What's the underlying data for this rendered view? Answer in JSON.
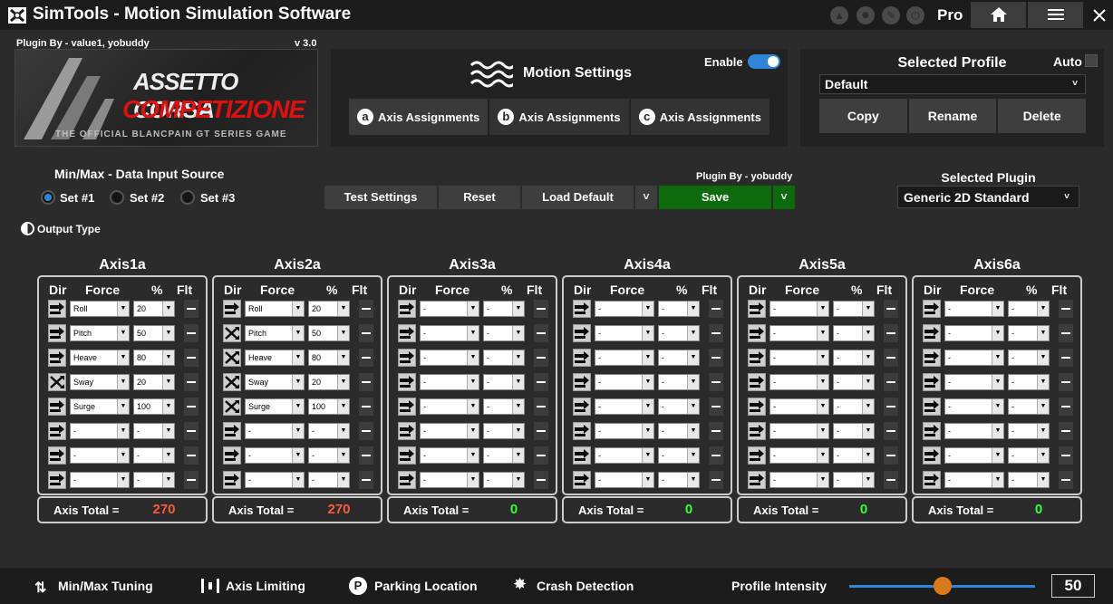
{
  "titlebar": {
    "title": "SimTools - Motion Simulation Software",
    "edition": "Pro",
    "icons": [
      "upload-icon",
      "badge-icon",
      "wrench-icon",
      "power-icon"
    ],
    "nav_buttons": [
      "home-icon",
      "menu-icon",
      "close-icon"
    ]
  },
  "plugin_info": {
    "authors": "Plugin By - value1, yobuddy",
    "version": "v 3.0",
    "image_text_line1": "ASSETTO CORSA",
    "image_text_line2": "COMPETIZIONE",
    "image_text_line3": "THE OFFICIAL BLANCPAIN GT SERIES GAME"
  },
  "motion_settings": {
    "title": "Motion Settings",
    "enable_label": "Enable",
    "tabs": [
      {
        "letter": "a",
        "label": "Axis Assignments"
      },
      {
        "letter": "b",
        "label": "Axis Assignments"
      },
      {
        "letter": "c",
        "label": "Axis Assignments"
      }
    ]
  },
  "profile": {
    "title": "Selected Profile",
    "auto_label": "Auto",
    "selected": "Default",
    "buttons": {
      "copy": "Copy",
      "rename": "Rename",
      "delete": "Delete"
    }
  },
  "data_source": {
    "title": "Min/Max - Data Input Source",
    "sets": [
      "Set #1",
      "Set #2",
      "Set #3"
    ],
    "selected": 0
  },
  "output_type": "Output Type",
  "actions": {
    "test": "Test Settings",
    "reset": "Reset",
    "load_default": "Load Default",
    "save": "Save",
    "plugin_by": "Plugin By - yobuddy"
  },
  "selected_plugin": {
    "title": "Selected Plugin",
    "value": "Generic 2D Standard"
  },
  "axis_headers": {
    "dir": "Dir",
    "force": "Force",
    "pct": "%",
    "flt": "Flt"
  },
  "axis_total_label": "Axis Total =",
  "axes": [
    {
      "name": "Axis1a",
      "total": "270",
      "total_color": "#ff5a3c",
      "rows": [
        {
          "dir": "normal",
          "force": "Roll",
          "pct": "20"
        },
        {
          "dir": "normal",
          "force": "Pitch",
          "pct": "50"
        },
        {
          "dir": "normal",
          "force": "Heave",
          "pct": "80"
        },
        {
          "dir": "reverse",
          "force": "Sway",
          "pct": "20"
        },
        {
          "dir": "normal",
          "force": "Surge",
          "pct": "100"
        },
        {
          "dir": "normal",
          "force": "-",
          "pct": "-"
        },
        {
          "dir": "normal",
          "force": "-",
          "pct": "-"
        },
        {
          "dir": "normal",
          "force": "-",
          "pct": "-"
        }
      ]
    },
    {
      "name": "Axis2a",
      "total": "270",
      "total_color": "#ff5a3c",
      "rows": [
        {
          "dir": "normal",
          "force": "Roll",
          "pct": "20"
        },
        {
          "dir": "reverse",
          "force": "Pitch",
          "pct": "50"
        },
        {
          "dir": "reverse",
          "force": "Heave",
          "pct": "80"
        },
        {
          "dir": "reverse",
          "force": "Sway",
          "pct": "20"
        },
        {
          "dir": "reverse",
          "force": "Surge",
          "pct": "100"
        },
        {
          "dir": "normal",
          "force": "-",
          "pct": "-"
        },
        {
          "dir": "normal",
          "force": "-",
          "pct": "-"
        },
        {
          "dir": "normal",
          "force": "-",
          "pct": "-"
        }
      ]
    },
    {
      "name": "Axis3a",
      "total": "0",
      "total_color": "#33ff33",
      "rows": [
        {
          "dir": "normal",
          "force": "-",
          "pct": "-"
        },
        {
          "dir": "normal",
          "force": "-",
          "pct": "-"
        },
        {
          "dir": "normal",
          "force": "-",
          "pct": "-"
        },
        {
          "dir": "normal",
          "force": "-",
          "pct": "-"
        },
        {
          "dir": "normal",
          "force": "-",
          "pct": "-"
        },
        {
          "dir": "normal",
          "force": "-",
          "pct": "-"
        },
        {
          "dir": "normal",
          "force": "-",
          "pct": "-"
        },
        {
          "dir": "normal",
          "force": "-",
          "pct": "-"
        }
      ]
    },
    {
      "name": "Axis4a",
      "total": "0",
      "total_color": "#33ff33",
      "rows": [
        {
          "dir": "normal",
          "force": "-",
          "pct": "-"
        },
        {
          "dir": "normal",
          "force": "-",
          "pct": "-"
        },
        {
          "dir": "normal",
          "force": "-",
          "pct": "-"
        },
        {
          "dir": "normal",
          "force": "-",
          "pct": "-"
        },
        {
          "dir": "normal",
          "force": "-",
          "pct": "-"
        },
        {
          "dir": "normal",
          "force": "-",
          "pct": "-"
        },
        {
          "dir": "normal",
          "force": "-",
          "pct": "-"
        },
        {
          "dir": "normal",
          "force": "-",
          "pct": "-"
        }
      ]
    },
    {
      "name": "Axis5a",
      "total": "0",
      "total_color": "#33ff33",
      "rows": [
        {
          "dir": "normal",
          "force": "-",
          "pct": "-"
        },
        {
          "dir": "normal",
          "force": "-",
          "pct": "-"
        },
        {
          "dir": "normal",
          "force": "-",
          "pct": "-"
        },
        {
          "dir": "normal",
          "force": "-",
          "pct": "-"
        },
        {
          "dir": "normal",
          "force": "-",
          "pct": "-"
        },
        {
          "dir": "normal",
          "force": "-",
          "pct": "-"
        },
        {
          "dir": "normal",
          "force": "-",
          "pct": "-"
        },
        {
          "dir": "normal",
          "force": "-",
          "pct": "-"
        }
      ]
    },
    {
      "name": "Axis6a",
      "total": "0",
      "total_color": "#33ff33",
      "rows": [
        {
          "dir": "normal",
          "force": "-",
          "pct": "-"
        },
        {
          "dir": "normal",
          "force": "-",
          "pct": "-"
        },
        {
          "dir": "normal",
          "force": "-",
          "pct": "-"
        },
        {
          "dir": "normal",
          "force": "-",
          "pct": "-"
        },
        {
          "dir": "normal",
          "force": "-",
          "pct": "-"
        },
        {
          "dir": "normal",
          "force": "-",
          "pct": "-"
        },
        {
          "dir": "normal",
          "force": "-",
          "pct": "-"
        },
        {
          "dir": "normal",
          "force": "-",
          "pct": "-"
        }
      ]
    }
  ],
  "bottom_bar": {
    "minmax": "Min/Max Tuning",
    "limiting": "Axis Limiting",
    "parking": "Parking Location",
    "crash": "Crash Detection",
    "intensity_label": "Profile Intensity",
    "intensity_value": "50",
    "intensity_fraction": 0.5
  },
  "colors": {
    "accent_blue": "#2f86d8",
    "save_green": "#0d6b0d",
    "slider_orange": "#d97b1a",
    "total_red": "#ff5a3c",
    "total_green": "#33ff33"
  }
}
